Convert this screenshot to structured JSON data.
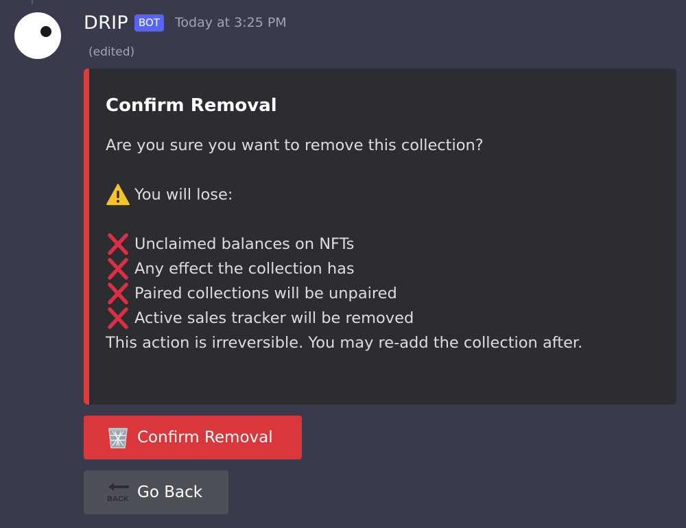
{
  "message": {
    "username": "DRIP",
    "bot_tag": "BOT",
    "timestamp": "Today at 3:25 PM",
    "edited_label": "(edited)"
  },
  "embed": {
    "accent_color": "#e23b3b",
    "title": "Confirm Removal",
    "question": "Are you sure you want to remove this collection?",
    "warning_label": "You will lose:",
    "loss_items": [
      "Unclaimed balances on NFTs",
      "Any effect the collection has",
      "Paired collections will be unpaired",
      "Active sales tracker will be removed"
    ],
    "footer_note": "This action is irreversible. You may re-add the collection after."
  },
  "buttons": {
    "confirm": {
      "label": "Confirm Removal",
      "icon": "wastebasket-icon",
      "color": "#da373c"
    },
    "back": {
      "label": "Go Back",
      "icon": "back-arrow-icon",
      "icon_text": "BACK",
      "color": "#4e5058"
    }
  }
}
